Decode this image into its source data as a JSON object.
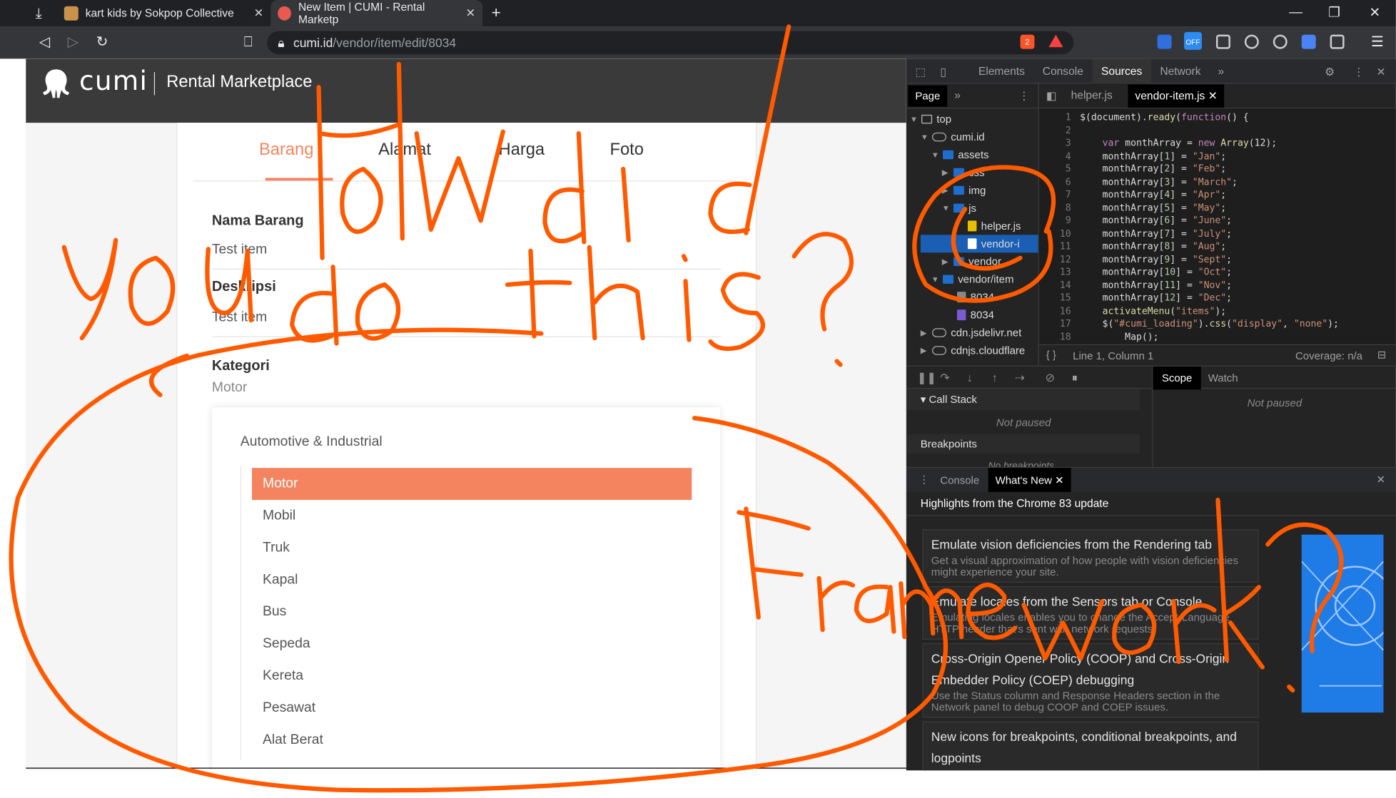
{
  "browser": {
    "tabs": [
      {
        "title": "kart kids by Sokpop Collective"
      },
      {
        "title": "New Item | CUMI - Rental Marketp"
      }
    ],
    "url_host": "cumi.id",
    "url_path": "/vendor/item/edit/8034",
    "brave_badge": "2",
    "ext_off_badge": "OFF"
  },
  "site": {
    "logo_text": "cumi",
    "title": "Rental Marketplace",
    "form_tabs": [
      "Barang",
      "Alamat",
      "Harga",
      "Foto"
    ],
    "active_tab": "Barang",
    "fields": {
      "nama_label": "Nama Barang",
      "nama_value": "Test item",
      "deskripsi_label": "Deskripsi",
      "deskripsi_value": "Test item",
      "kategori_label": "Kategori",
      "kategori_value": "Motor"
    },
    "category_group": "Automotive & Industrial",
    "category_options": [
      "Motor",
      "Mobil",
      "Truk",
      "Kapal",
      "Bus",
      "Sepeda",
      "Kereta",
      "Pesawat",
      "Alat Berat"
    ],
    "selected_option": "Motor"
  },
  "devtools": {
    "panel_tabs": [
      "Elements",
      "Console",
      "Sources",
      "Network"
    ],
    "active_panel": "Sources",
    "navigator_tab": "Page",
    "file_tabs": [
      "helper.js",
      "vendor-item.js"
    ],
    "active_file": "vendor-item.js",
    "tree": [
      {
        "label": "top",
        "icon": "frame"
      },
      {
        "label": "cumi.id",
        "icon": "cloud"
      },
      {
        "label": "assets",
        "icon": "folder"
      },
      {
        "label": "css",
        "icon": "folder"
      },
      {
        "label": "img",
        "icon": "folder"
      },
      {
        "label": "js",
        "icon": "folder"
      },
      {
        "label": "helper.js",
        "icon": "file-js"
      },
      {
        "label": "vendor-i",
        "icon": "file"
      },
      {
        "label": "vendor",
        "icon": "folder"
      },
      {
        "label": "vendor/item",
        "icon": "folder"
      },
      {
        "label": "8034",
        "icon": "file-purple"
      },
      {
        "label": "8034",
        "icon": "file-purple"
      },
      {
        "label": "cdn.jsdelivr.net",
        "icon": "cloud"
      },
      {
        "label": "cdnjs.cloudflare",
        "icon": "cloud"
      }
    ],
    "code_lines": [
      "$(document).ready(function() {",
      "",
      "    var monthArray = new Array(12);",
      "    monthArray[1] = \"Jan\";",
      "    monthArray[2] = \"Feb\";",
      "    monthArray[3] = \"March\";",
      "    monthArray[4] = \"Apr\";",
      "    monthArray[5] = \"May\";",
      "    monthArray[6] = \"June\";",
      "    monthArray[7] = \"July\";",
      "    monthArray[8] = \"Aug\";",
      "    monthArray[9] = \"Sept\";",
      "    monthArray[10] = \"Oct\";",
      "    monthArray[11] = \"Nov\";",
      "    monthArray[12] = \"Dec\";",
      "    activateMenu(\"items\");",
      "    $(\"#cumi_loading\").css(\"display\", \"none\");",
      "        Map();"
    ],
    "status_position": "Line 1, Column 1",
    "coverage": "Coverage: n/a",
    "call_stack_label": "Call Stack",
    "not_paused": "Not paused",
    "breakpoints_label": "Breakpoints",
    "no_breakpoints": "No breakpoints",
    "scope_tab": "Scope",
    "watch_tab": "Watch",
    "drawer_tabs": [
      "Console",
      "What's New"
    ],
    "active_drawer": "What's New",
    "whatsnew_title": "Highlights from the Chrome 83 update",
    "whatsnew_items": [
      {
        "title": "Emulate vision deficiencies from the Rendering tab",
        "desc": "Get a visual approximation of how people with vision deficiencies might experience your site."
      },
      {
        "title": "Emulate locales from the Sensors tab or Console",
        "desc": "Emulating locales enables you to change the Accept-Language HTTP header that's sent with network requests."
      },
      {
        "title": "Cross-Origin Opener Policy (COOP) and Cross-Origin Embedder Policy (COEP) debugging",
        "desc": "Use the Status column and Response Headers section in the Network panel to debug COOP and COEP issues."
      },
      {
        "title": "New icons for breakpoints, conditional breakpoints, and logpoints",
        "desc": ""
      }
    ]
  },
  "annotation": {
    "handwriting": [
      "How did",
      "you do this?",
      "Framework?"
    ],
    "ink_color": "#ff5a00"
  }
}
